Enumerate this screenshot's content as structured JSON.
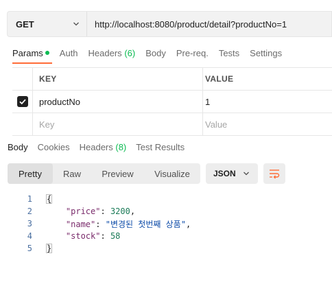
{
  "request": {
    "method": "GET",
    "url": "http://localhost:8080/product/detail?productNo=1"
  },
  "request_tabs": [
    {
      "label": "Params",
      "active": true,
      "indicator": "green-dot"
    },
    {
      "label": "Auth"
    },
    {
      "label": "Headers",
      "count": "(6)"
    },
    {
      "label": "Body"
    },
    {
      "label": "Pre-req."
    },
    {
      "label": "Tests"
    },
    {
      "label": "Settings"
    }
  ],
  "params": {
    "headers": {
      "key": "KEY",
      "value": "VALUE"
    },
    "rows": [
      {
        "checked": true,
        "key": "productNo",
        "value": "1"
      }
    ],
    "placeholder": {
      "key": "Key",
      "value": "Value"
    }
  },
  "response_tabs": [
    {
      "label": "Body",
      "active": true
    },
    {
      "label": "Cookies"
    },
    {
      "label": "Headers",
      "count": "(8)"
    },
    {
      "label": "Test Results"
    }
  ],
  "view_modes": [
    {
      "label": "Pretty",
      "active": true
    },
    {
      "label": "Raw"
    },
    {
      "label": "Preview"
    },
    {
      "label": "Visualize"
    }
  ],
  "format": "JSON",
  "code_lines": [
    {
      "no": "1"
    },
    {
      "no": "2"
    },
    {
      "no": "3"
    },
    {
      "no": "4"
    },
    {
      "no": "5"
    }
  ],
  "body": {
    "open": "{",
    "close": "}",
    "price_key": "\"price\"",
    "price_val": "3200",
    "name_key": "\"name\"",
    "name_val": "\"변경된 첫번째 상품\"",
    "stock_key": "\"stock\"",
    "stock_val": "58"
  },
  "colors": {
    "accent": "#ff6c37",
    "success": "#0cbb52"
  }
}
